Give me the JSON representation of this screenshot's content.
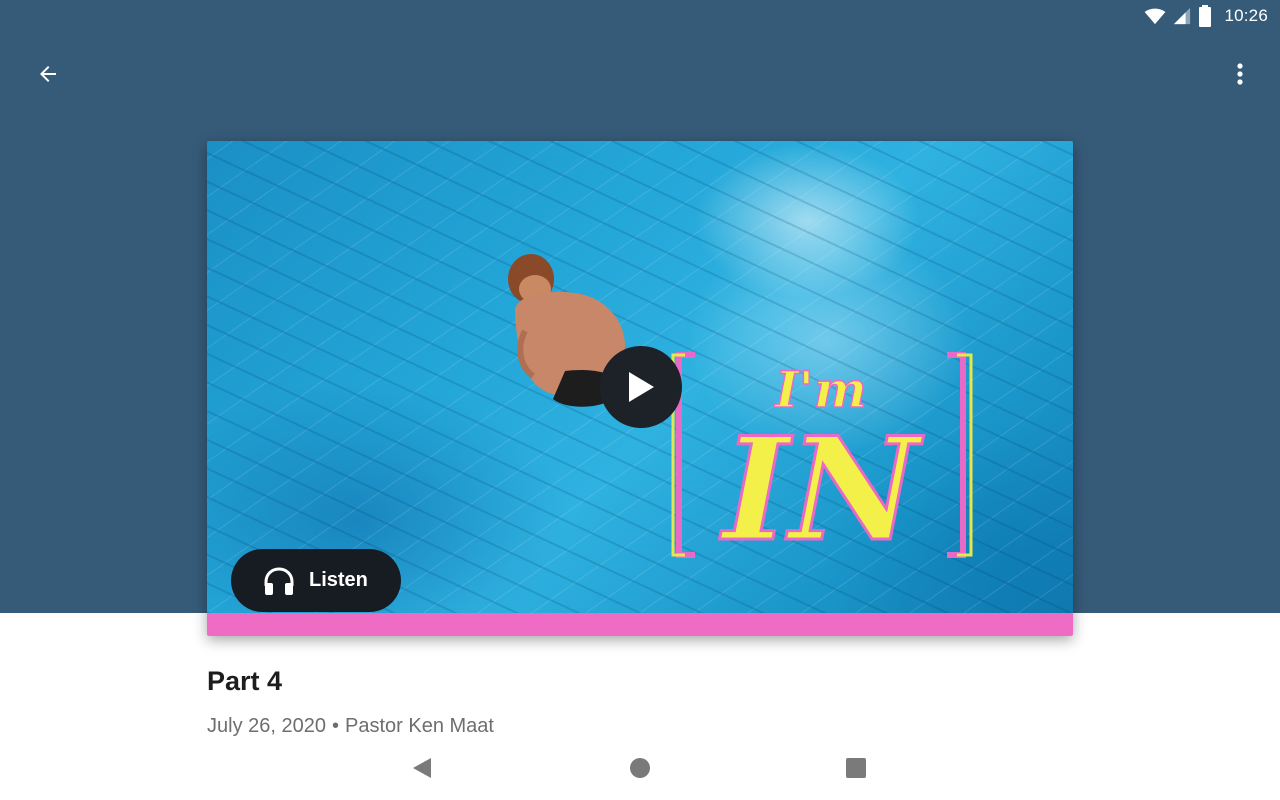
{
  "status_bar": {
    "time": "10:26",
    "icons": [
      "wifi-icon",
      "cell-signal-icon",
      "battery-icon"
    ]
  },
  "toolbar": {
    "back_icon": "arrow-left-icon",
    "more_icon": "more-vertical-icon"
  },
  "media": {
    "artwork_title_line1": "I'm",
    "artwork_title_line2": "IN",
    "play_icon": "play-icon",
    "listen_label": "Listen",
    "listen_icon": "headphones-icon"
  },
  "content": {
    "title": "Part 4",
    "date": "July 26, 2020",
    "separator": "•",
    "speaker": "Pastor Ken Maat"
  },
  "nav": {
    "back_icon": "nav-back-icon",
    "home_icon": "nav-home-icon",
    "recents_icon": "nav-recents-icon"
  },
  "colors": {
    "header": "#365b79",
    "accent_pink": "#ef6cc5",
    "title_yellow": "#f4f04a",
    "bracket_pink": "#e86ac6",
    "bracket_yellow": "#e6e84a",
    "button_dark": "#161c22"
  }
}
